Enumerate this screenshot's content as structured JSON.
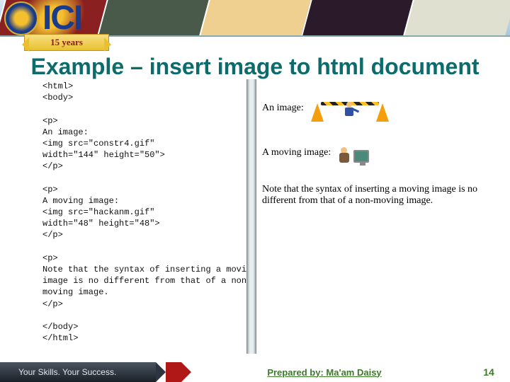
{
  "header": {
    "logo_text": "ICI",
    "ribbon_text": "15  years"
  },
  "slide": {
    "title": "Example – insert image to html document"
  },
  "code": {
    "lines": "<html>\n<body>\n\n<p>\nAn image:\n<img src=\"constr4.gif\"\nwidth=\"144\" height=\"50\">\n</p>\n\n<p>\nA moving image:\n<img src=\"hackanm.gif\"\nwidth=\"48\" height=\"48\">\n</p>\n\n<p>\nNote that the syntax of inserting a moving\nimage is no different from that of a non-\nmoving image.\n</p>\n\n</body>\n</html>"
  },
  "rendered": {
    "image_label": "An image:",
    "moving_label": "A moving image:",
    "note": "Note that the syntax of inserting a moving image is no different from that of a non-moving image."
  },
  "footer": {
    "tagline": "Your Skills. Your Success.",
    "prepared_by": "Prepared by: Ma'am Daisy",
    "page_number": "14"
  }
}
